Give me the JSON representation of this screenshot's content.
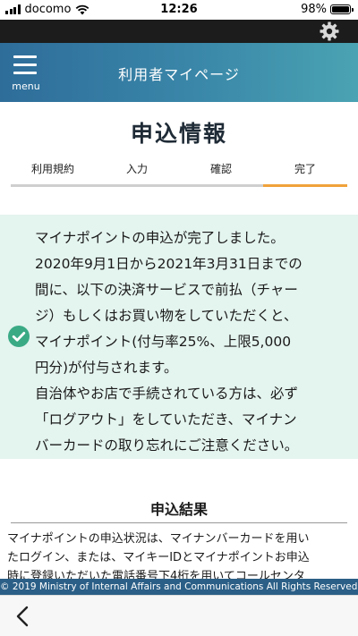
{
  "status_bar": {
    "carrier": "docomo",
    "time": "12:26",
    "battery": "98%"
  },
  "header": {
    "menu_label": "menu",
    "title": "利用者マイページ"
  },
  "page": {
    "title": "申込情報"
  },
  "steps": [
    {
      "label": "利用規約",
      "active": false
    },
    {
      "label": "入力",
      "active": false
    },
    {
      "label": "確認",
      "active": false
    },
    {
      "label": "完了",
      "active": true
    }
  ],
  "notice": {
    "lines": [
      "マイナポイントの申込が完了しました。",
      "2020年9月1日から2021年3月31日までの",
      "間に、以下の決済サービスで前払（チャー",
      "ジ）もしくはお買い物をしていただくと、",
      "マイナポイント(付与率25%、上限5,000",
      "円分)が付与されます。",
      "自治体やお店で手続されている方は、必ず",
      "「ログアウト」をしていただき、マイナン",
      "バーカードの取り忘れにご注意ください。"
    ]
  },
  "result": {
    "title": "申込結果",
    "lines": [
      "マイナポイントの申込状況は、マイナンバーカードを用い",
      "たログイン、または、マイキーIDとマイナポイントお申込",
      "時に登録いただいた電話番号下4桁を用いてコールセンタ"
    ]
  },
  "footer": {
    "copyright": "© 2019 Ministry of Internal Affairs and Communications All Rights Reserved."
  },
  "icons": {
    "settings": "gear-icon",
    "menu": "hamburger-icon",
    "complete": "check-circle-icon",
    "back": "chevron-left-icon"
  },
  "colors": {
    "header_start": "#2e6d9a",
    "header_end": "#4aa3b2",
    "active_step": "#f0a23a",
    "notice_bg": "#e4f4ef",
    "check": "#3aaa85",
    "footer_bg": "#2b5f87"
  }
}
